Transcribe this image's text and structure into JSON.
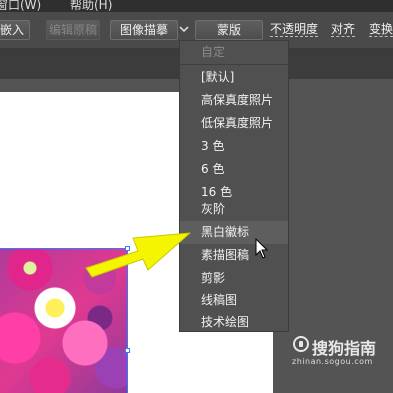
{
  "menubar": {
    "items": [
      "窗口(W)",
      "帮助(H)"
    ]
  },
  "toolbar": {
    "embed_label": "嵌入",
    "edit_original_label": "编辑原稿",
    "image_trace_label": "图像描摹",
    "preset_label": "蒙版",
    "opacity_label": "不透明度",
    "align_label": "对齐",
    "transform_label": "变换"
  },
  "trace_menu": {
    "items": [
      {
        "label": "自定",
        "enabled": false,
        "highlighted": false
      },
      {
        "label": "[默认]",
        "enabled": true,
        "highlighted": false
      },
      {
        "label": "高保真度照片",
        "enabled": true,
        "highlighted": false
      },
      {
        "label": "低保真度照片",
        "enabled": true,
        "highlighted": false
      },
      {
        "label": "3 色",
        "enabled": true,
        "highlighted": false
      },
      {
        "label": "6 色",
        "enabled": true,
        "highlighted": false
      },
      {
        "label": "16 色",
        "enabled": true,
        "highlighted": false
      },
      {
        "label": "灰阶",
        "enabled": true,
        "highlighted": false
      },
      {
        "label": "黑白徽标",
        "enabled": true,
        "highlighted": true
      },
      {
        "label": "素描图稿",
        "enabled": true,
        "highlighted": false
      },
      {
        "label": "剪影",
        "enabled": true,
        "highlighted": false
      },
      {
        "label": "线稿图",
        "enabled": true,
        "highlighted": false
      },
      {
        "label": "技术绘图",
        "enabled": true,
        "highlighted": false
      }
    ]
  },
  "colors": {
    "arrow": "#f5f500",
    "selection": "#2f7dff"
  },
  "icons": {
    "dropdown": "chevron-down-icon",
    "cursor": "mouse-pointer-icon",
    "annotation": "yellow-arrow-annotation",
    "watermark_logo": "sogou-logo-icon"
  },
  "watermark": {
    "brand": "搜狗指南",
    "url": "zhinan.sogou.com"
  }
}
